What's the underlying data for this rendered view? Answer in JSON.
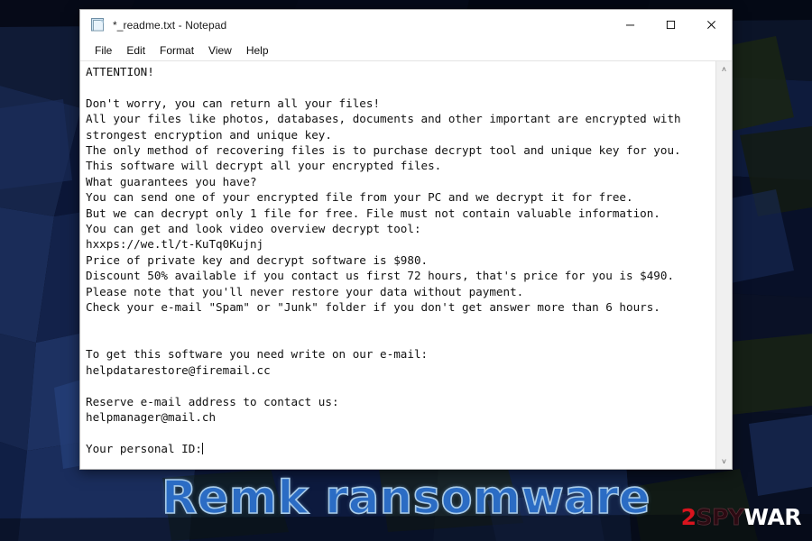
{
  "window": {
    "title": "*_readme.txt - Notepad",
    "icon": "notepad-icon",
    "menus": [
      "File",
      "Edit",
      "Format",
      "View",
      "Help"
    ],
    "controls": {
      "minimize": "─",
      "maximize": "□",
      "close": "✕"
    },
    "scrollbar": {
      "up_arrow": "˄",
      "down_arrow": "˅"
    }
  },
  "note": {
    "lines": [
      "ATTENTION!",
      "",
      "Don't worry, you can return all your files!",
      "All your files like photos, databases, documents and other important are encrypted with",
      "strongest encryption and unique key.",
      "The only method of recovering files is to purchase decrypt tool and unique key for you.",
      "This software will decrypt all your encrypted files.",
      "What guarantees you have?",
      "You can send one of your encrypted file from your PC and we decrypt it for free.",
      "But we can decrypt only 1 file for free. File must not contain valuable information.",
      "You can get and look video overview decrypt tool:",
      "hxxps://we.tl/t-KuTq0Kujnj",
      "Price of private key and decrypt software is $980.",
      "Discount 50% available if you contact us first 72 hours, that's price for you is $490.",
      "Please note that you'll never restore your data without payment.",
      "Check your e-mail \"Spam\" or \"Junk\" folder if you don't get answer more than 6 hours.",
      "",
      "",
      "To get this software you need write on our e-mail:",
      "helpdatarestore@firemail.cc",
      "",
      "Reserve e-mail address to contact us:",
      "helpmanager@mail.ch",
      "",
      "Your personal ID:"
    ],
    "price_full": "$980",
    "price_discount": "$490",
    "discount_percent": "50%",
    "discount_window_hours": "72",
    "response_window_hours": "6",
    "video_url": "hxxps://we.tl/t-KuTq0Kujnj",
    "primary_email": "helpdatarestore@firemail.cc",
    "reserve_email": "helpmanager@mail.ch"
  },
  "overlay": {
    "watermark": "Remk ransomware",
    "brand": {
      "part1": "2",
      "part2": "SPY",
      "part3": "WAR"
    }
  },
  "colors": {
    "watermark_fill": "#2b6cc4",
    "watermark_outline": "#a9cbe8",
    "brand_red": "#d8141e",
    "brand_white": "#ffffff",
    "wallpaper_base": "#0b1226",
    "window_bg": "#ffffff"
  }
}
